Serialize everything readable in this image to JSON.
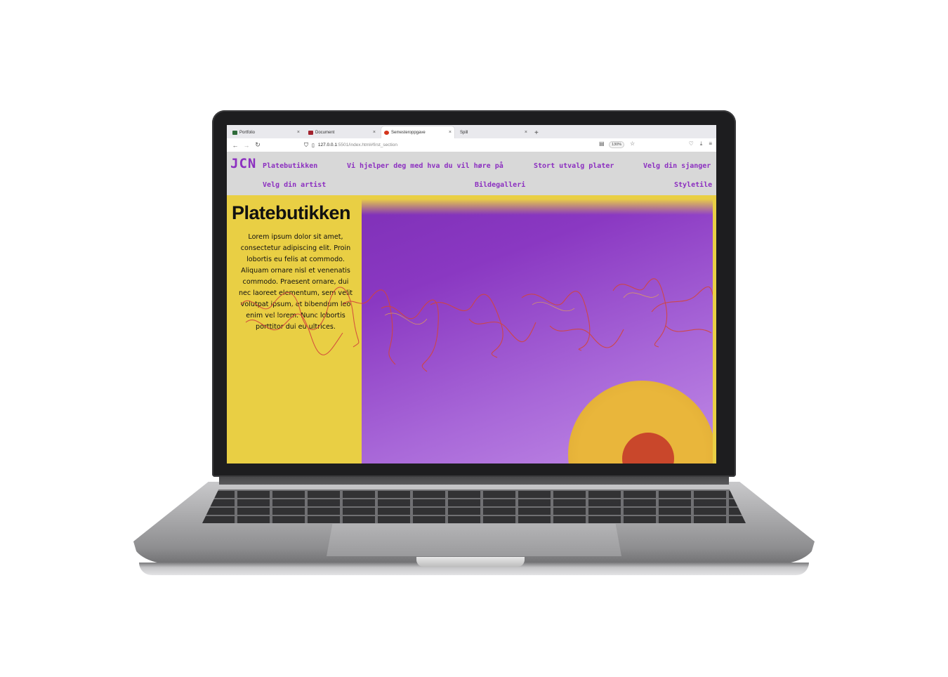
{
  "browser": {
    "tabs": [
      {
        "label": "Portfolio",
        "favicon_color": "#2f6b3a",
        "active": false
      },
      {
        "label": "Document",
        "favicon_color": "#a3232e",
        "active": false
      },
      {
        "label": "Semesteroppgave",
        "favicon_color": "#d4351c",
        "active": true
      },
      {
        "label": "Spill",
        "favicon_color": "",
        "active": false
      }
    ],
    "new_tab": "+",
    "tab_close": "×",
    "url_host": "127.0.0.1",
    "url_rest": ":5501/index.html#first_section",
    "zoom": "130%",
    "icons": [
      "back-icon",
      "forward-icon",
      "reload-icon",
      "shield-icon",
      "page-icon",
      "reader-icon",
      "bookmark-star-icon",
      "pocket-icon",
      "download-icon",
      "menu-icon"
    ]
  },
  "site": {
    "logo": "JCN",
    "nav": [
      "Platebutikken",
      "Vi hjelper deg med hva du vil høre på",
      "Stort utvalg plater",
      "Velg din sjanger",
      "Velg din artist",
      "Bildegalleri",
      "Styletile"
    ],
    "colors": {
      "accent": "#8c2fc0",
      "yellow": "#e9cf44",
      "purple": "#7a2db3"
    }
  },
  "hero": {
    "title": "Platebutikken",
    "text": "Lorem ipsum dolor sit amet, consectetur adipiscing elit. Proin lobortis eu felis at commodo. Aliquam ornare nisl et venenatis commodo. Praesent ornare, dui nec laoreet elementum, sem velit volutpat ipsum, et bibendum leo enim vel lorem. Nunc lobortis porttitor dui eu ultrices."
  }
}
